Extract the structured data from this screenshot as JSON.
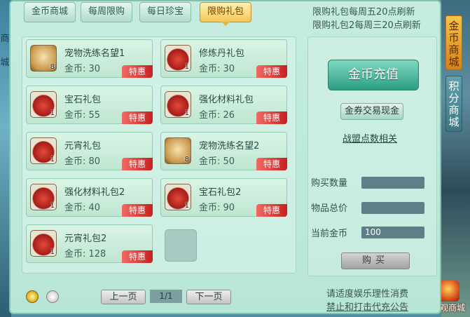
{
  "tabs": [
    {
      "label": "金币商城",
      "active": false
    },
    {
      "label": "每周限购",
      "active": false
    },
    {
      "label": "每日珍宝",
      "active": false
    },
    {
      "label": "限购礼包",
      "active": true
    }
  ],
  "notice": {
    "line1": "限购礼包每周五20点刷新",
    "line2": "限购礼包2每周三20点刷新"
  },
  "items": [
    {
      "name": "宠物洗练名望1",
      "price": "金币: 30",
      "count": "8",
      "tag": "特惠",
      "icon": "paw-badge-icon"
    },
    {
      "name": "修炼丹礼包",
      "price": "金币: 30",
      "count": "1",
      "tag": "特惠",
      "icon": "gift-bag-icon"
    },
    {
      "name": "宝石礼包",
      "price": "金币: 55",
      "count": "1",
      "tag": "特惠",
      "icon": "gift-bag-icon"
    },
    {
      "name": "强化材料礼包",
      "price": "金币: 26",
      "count": "1",
      "tag": "特惠",
      "icon": "gift-bag-icon"
    },
    {
      "name": "元宵礼包",
      "price": "金币: 80",
      "count": "1",
      "tag": "特惠",
      "icon": "gift-bag-icon"
    },
    {
      "name": "宠物洗练名望2",
      "price": "金币: 50",
      "count": "8",
      "tag": "特惠",
      "icon": "paw-badge-icon"
    },
    {
      "name": "强化材料礼包2",
      "price": "金币: 40",
      "count": "1",
      "tag": "特惠",
      "icon": "gift-bag-icon"
    },
    {
      "name": "宝石礼包2",
      "price": "金币: 90",
      "count": "1",
      "tag": "特惠",
      "icon": "gift-bag-icon"
    },
    {
      "name": "元宵礼包2",
      "price": "金币: 128",
      "count": "1",
      "tag": "特惠",
      "icon": "gift-bag-icon"
    }
  ],
  "right": {
    "recharge": "金币充值",
    "exchange": "金券交易现金",
    "alliance": "战盟点数相关",
    "buy_qty_label": "购买数量",
    "total_label": "物品总价",
    "current_gold_label": "当前金币",
    "buy_qty_value": "",
    "total_value": "",
    "current_gold_value": "100",
    "buy_button": "购买"
  },
  "pager": {
    "prev": "上一页",
    "page": "1/1",
    "next": "下一页"
  },
  "footer": {
    "line1": "请适度娱乐理性消费",
    "line2": "禁止和打击代充公告"
  },
  "side_tabs": {
    "gold_mall": "金币商城",
    "points_mall": "积分商城",
    "appearance_mall": "外观商城"
  },
  "left_edge": {
    "top": "商",
    "mid": "城"
  },
  "colors": {
    "tag": "#c8201f",
    "accent": "#2b9e83",
    "active_tab": "#f3c658"
  }
}
